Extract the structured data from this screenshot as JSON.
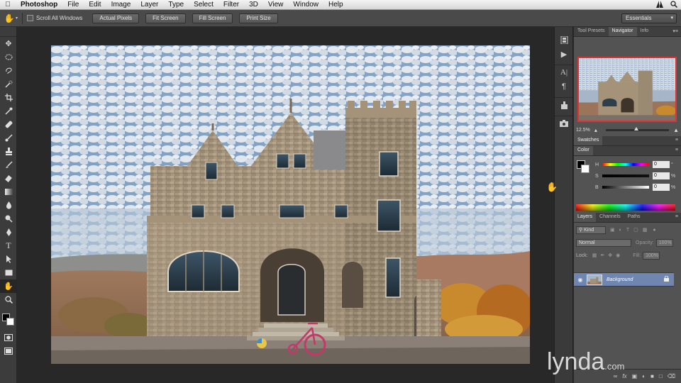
{
  "menubar": {
    "app_name": "Photoshop",
    "items": [
      "File",
      "Edit",
      "Image",
      "Layer",
      "Type",
      "Select",
      "Filter",
      "3D",
      "View",
      "Window",
      "Help"
    ]
  },
  "options": {
    "scroll_all_windows": "Scroll All Windows",
    "buttons": [
      "Actual Pixels",
      "Fit Screen",
      "Fill Screen",
      "Print Size"
    ],
    "workspace": "Essentials"
  },
  "navigator_panel": {
    "tabs": [
      "Tool Presets",
      "Navigator",
      "Info"
    ],
    "active_tab": "Navigator",
    "zoom": "12.5%"
  },
  "swatches_panel": {
    "tab": "Swatches"
  },
  "color_panel": {
    "tab": "Color",
    "rows": [
      {
        "label": "H",
        "value": "0",
        "unit": "°"
      },
      {
        "label": "S",
        "value": "0",
        "unit": "%"
      },
      {
        "label": "B",
        "value": "0",
        "unit": "%"
      }
    ]
  },
  "layers_panel": {
    "tabs": [
      "Layers",
      "Channels",
      "Paths"
    ],
    "active_tab": "Layers",
    "kind": "Kind",
    "blend_mode": "Normal",
    "opacity_label": "Opacity:",
    "opacity": "100%",
    "lock_label": "Lock:",
    "fill_label": "Fill:",
    "fill": "100%",
    "layer_name": "Background"
  },
  "watermark": {
    "brand": "lynda",
    "suffix": ".com"
  }
}
